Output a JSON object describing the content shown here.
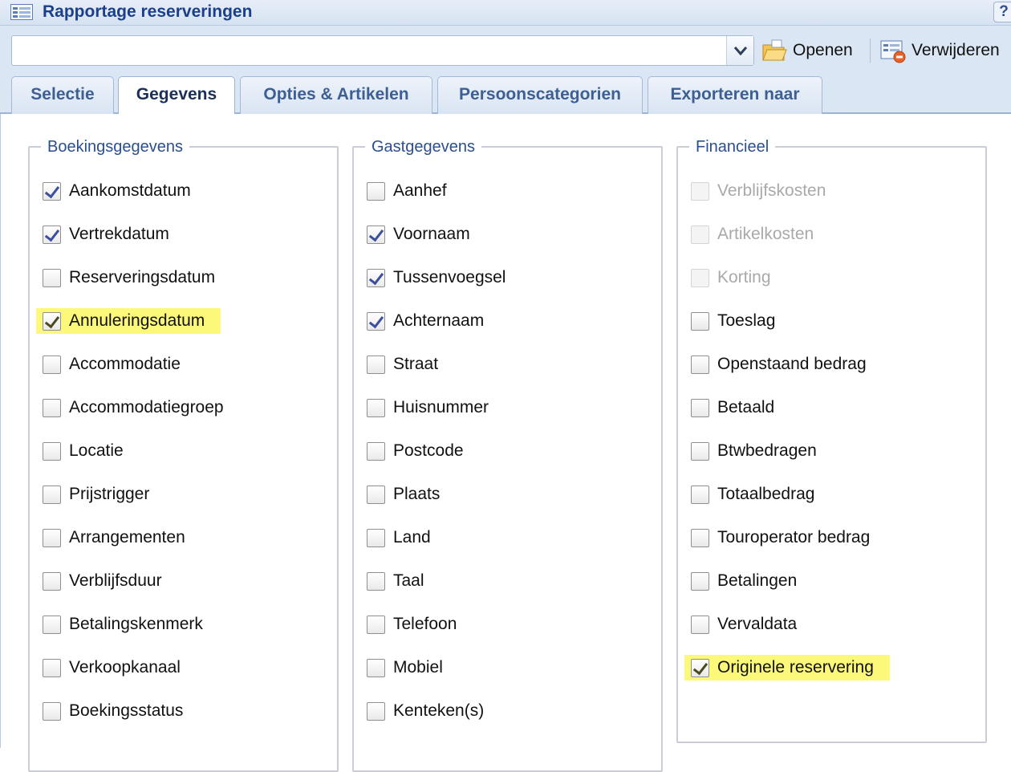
{
  "window": {
    "title": "Rapportage reserveringen",
    "help_label": "?"
  },
  "toolbar": {
    "report_select": {
      "value": "",
      "placeholder": ""
    },
    "open_label": "Openen",
    "delete_label": "Verwijderen"
  },
  "tabs": [
    {
      "label": "Selectie",
      "active": false
    },
    {
      "label": "Gegevens",
      "active": true
    },
    {
      "label": "Opties & Artikelen",
      "active": false
    },
    {
      "label": "Persoonscategorien",
      "active": false
    },
    {
      "label": "Exporteren naar",
      "active": false
    }
  ],
  "groups": {
    "booking": {
      "legend": "Boekingsgegevens",
      "items": [
        {
          "label": "Aankomstdatum",
          "checked": true
        },
        {
          "label": "Vertrekdatum",
          "checked": true
        },
        {
          "label": "Reserveringsdatum",
          "checked": false
        },
        {
          "label": "Annuleringsdatum",
          "checked": true,
          "highlighted": true
        },
        {
          "label": "Accommodatie",
          "checked": false
        },
        {
          "label": "Accommodatiegroep",
          "checked": false
        },
        {
          "label": "Locatie",
          "checked": false
        },
        {
          "label": "Prijstrigger",
          "checked": false
        },
        {
          "label": "Arrangementen",
          "checked": false
        },
        {
          "label": "Verblijfsduur",
          "checked": false
        },
        {
          "label": "Betalingskenmerk",
          "checked": false
        },
        {
          "label": "Verkoopkanaal",
          "checked": false
        },
        {
          "label": "Boekingsstatus",
          "checked": false
        }
      ]
    },
    "guest": {
      "legend": "Gastgegevens",
      "items": [
        {
          "label": "Aanhef",
          "checked": false
        },
        {
          "label": "Voornaam",
          "checked": true
        },
        {
          "label": "Tussenvoegsel",
          "checked": true
        },
        {
          "label": "Achternaam",
          "checked": true
        },
        {
          "label": "Straat",
          "checked": false
        },
        {
          "label": "Huisnummer",
          "checked": false
        },
        {
          "label": "Postcode",
          "checked": false
        },
        {
          "label": "Plaats",
          "checked": false
        },
        {
          "label": "Land",
          "checked": false
        },
        {
          "label": "Taal",
          "checked": false
        },
        {
          "label": "Telefoon",
          "checked": false
        },
        {
          "label": "Mobiel",
          "checked": false
        },
        {
          "label": "Kenteken(s)",
          "checked": false
        }
      ]
    },
    "financial": {
      "legend": "Financieel",
      "items": [
        {
          "label": "Verblijfskosten",
          "checked": false,
          "disabled": true
        },
        {
          "label": "Artikelkosten",
          "checked": false,
          "disabled": true
        },
        {
          "label": "Korting",
          "checked": false,
          "disabled": true
        },
        {
          "label": "Toeslag",
          "checked": false
        },
        {
          "label": "Openstaand bedrag",
          "checked": false
        },
        {
          "label": "Betaald",
          "checked": false
        },
        {
          "label": "Btwbedragen",
          "checked": false
        },
        {
          "label": "Totaalbedrag",
          "checked": false
        },
        {
          "label": "Touroperator bedrag",
          "checked": false
        },
        {
          "label": "Betalingen",
          "checked": false
        },
        {
          "label": "Vervaldata",
          "checked": false
        },
        {
          "label": "Originele reservering",
          "checked": true,
          "highlighted": true
        }
      ]
    }
  },
  "colors": {
    "highlight": "#fbf87a",
    "title_text": "#1c3f8a",
    "toolbar_bg": "#dbe6f4",
    "legend_text": "#2a4f8f"
  }
}
